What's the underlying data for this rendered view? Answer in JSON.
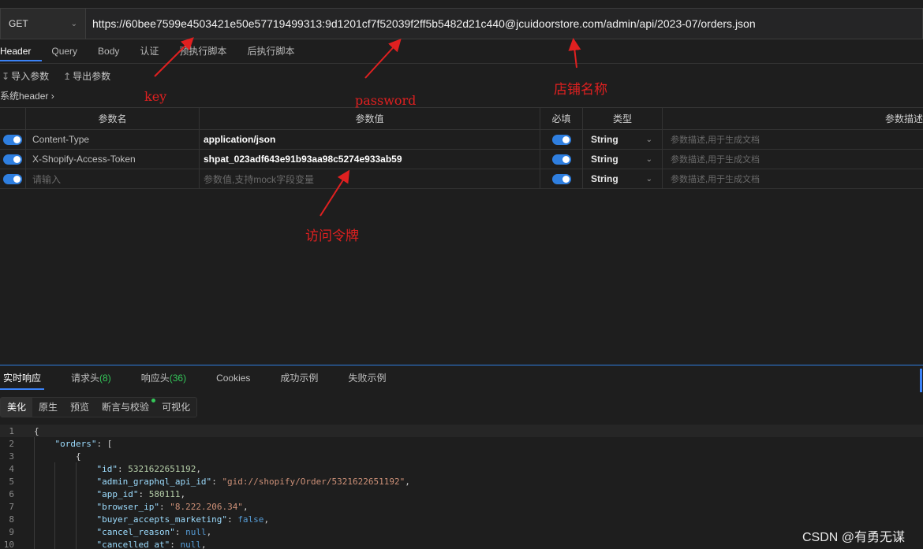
{
  "request": {
    "method": "GET",
    "url": "https://60bee7599e4503421e50e57719499313:9d1201cf7f52039f2ff5b5482d21c440@jcuidoorstore.com/admin/api/2023-07/orders.json"
  },
  "request_tabs": [
    "Header",
    "Query",
    "Body",
    "认证",
    "预执行脚本",
    "后执行脚本"
  ],
  "tools": {
    "import": "导入参数",
    "export": "导出参数"
  },
  "system_header": "系统header",
  "table": {
    "headers": {
      "name": "参数名",
      "value": "参数值",
      "required": "必填",
      "type": "类型",
      "desc": "参数描述"
    },
    "rows": [
      {
        "name": "Content-Type",
        "value": "application/json",
        "type": "String",
        "desc_placeholder": "参数描述,用于生成文档"
      },
      {
        "name": "X-Shopify-Access-Token",
        "value": "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",
        "type": "String",
        "desc_placeholder": "参数描述,用于生成文档"
      },
      {
        "name_placeholder": "请输入",
        "value_placeholder": "参数值,支持mock字段变量",
        "type": "String",
        "desc_placeholder": "参数描述,用于生成文档"
      }
    ]
  },
  "annotations": {
    "key": "key",
    "password": "password",
    "store": "店铺名称",
    "token": "访问令牌"
  },
  "response_tabs": {
    "realtime": "实时响应",
    "req_headers": "请求头",
    "req_headers_count": "(8)",
    "resp_headers": "响应头",
    "resp_headers_count": "(36)",
    "cookies": "Cookies",
    "success": "成功示例",
    "fail": "失败示例"
  },
  "view_tabs": [
    "美化",
    "原生",
    "预览",
    "断言与校验",
    "可视化"
  ],
  "code_lines": [
    "1",
    "2",
    "3",
    "4",
    "5",
    "6",
    "7",
    "8",
    "9",
    "10"
  ],
  "json": {
    "orders_key": "\"orders\"",
    "id_key": "\"id\"",
    "id_val": "5321622651192",
    "gql_key": "\"admin_graphql_api_id\"",
    "gql_val": "\"gid://shopify/Order/5321622651192\"",
    "app_key": "\"app_id\"",
    "app_val": "580111",
    "ip_key": "\"browser_ip\"",
    "ip_val": "\"8.222.206.34\"",
    "mkt_key": "\"buyer_accepts_marketing\"",
    "mkt_val": "false",
    "cr_key": "\"cancel_reason\"",
    "cr_val": "null",
    "ca_key": "\"cancelled_at\"",
    "ca_val": "null"
  },
  "watermark": "CSDN @有勇无谋",
  "colors": {
    "accent": "#2f7fe0",
    "annotation": "#e02020",
    "success": "#34c759"
  }
}
